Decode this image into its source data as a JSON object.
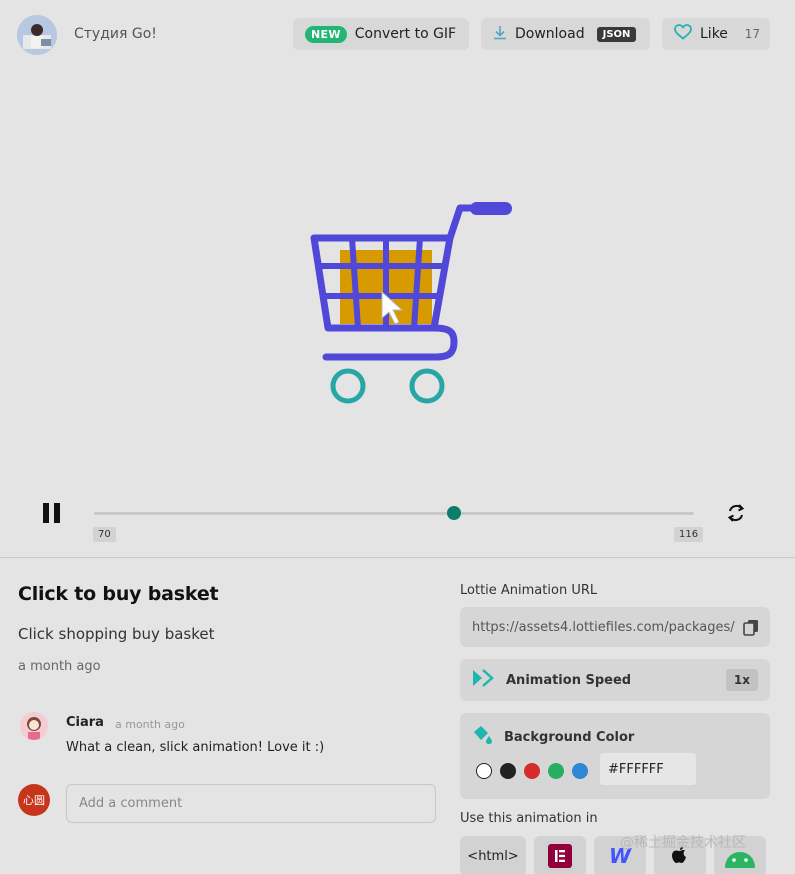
{
  "header": {
    "author_name": "Студия Go!",
    "convert_badge": "NEW",
    "convert_label": "Convert to GIF",
    "download_label": "Download",
    "download_format": "JSON",
    "like_label": "Like",
    "like_count": "17"
  },
  "player": {
    "frame_start": "70",
    "frame_end": "116",
    "progress": 0.6
  },
  "animation": {
    "title": "Click to buy basket",
    "description": "Click shopping buy basket",
    "posted": "a month ago"
  },
  "comments": [
    {
      "author": "Ciara",
      "time": "a month ago",
      "text": "What a clean, slick animation! Love it :)"
    }
  ],
  "comment_box": {
    "avatar_text": "心圆",
    "placeholder": "Add a comment"
  },
  "sidebar": {
    "url_label": "Lottie Animation URL",
    "url_value": "https://assets4.lottiefiles.com/packages/",
    "speed_label": "Animation Speed",
    "speed_value": "1x",
    "bg_label": "Background Color",
    "bg_value": "#FFFFFF",
    "swatches": [
      "#ffffff",
      "#222222",
      "#d62b2b",
      "#27ae60",
      "#2f86d6"
    ],
    "use_label": "Use this animation in",
    "integrations": [
      "<html>",
      "E",
      "W",
      "",
      ""
    ]
  },
  "colors": {
    "accent": "#0b7e6a",
    "cart": "#5147d8",
    "box": "#d79a00",
    "wheels": "#26a7a5"
  },
  "watermark": "@稀土掘金技术社区"
}
